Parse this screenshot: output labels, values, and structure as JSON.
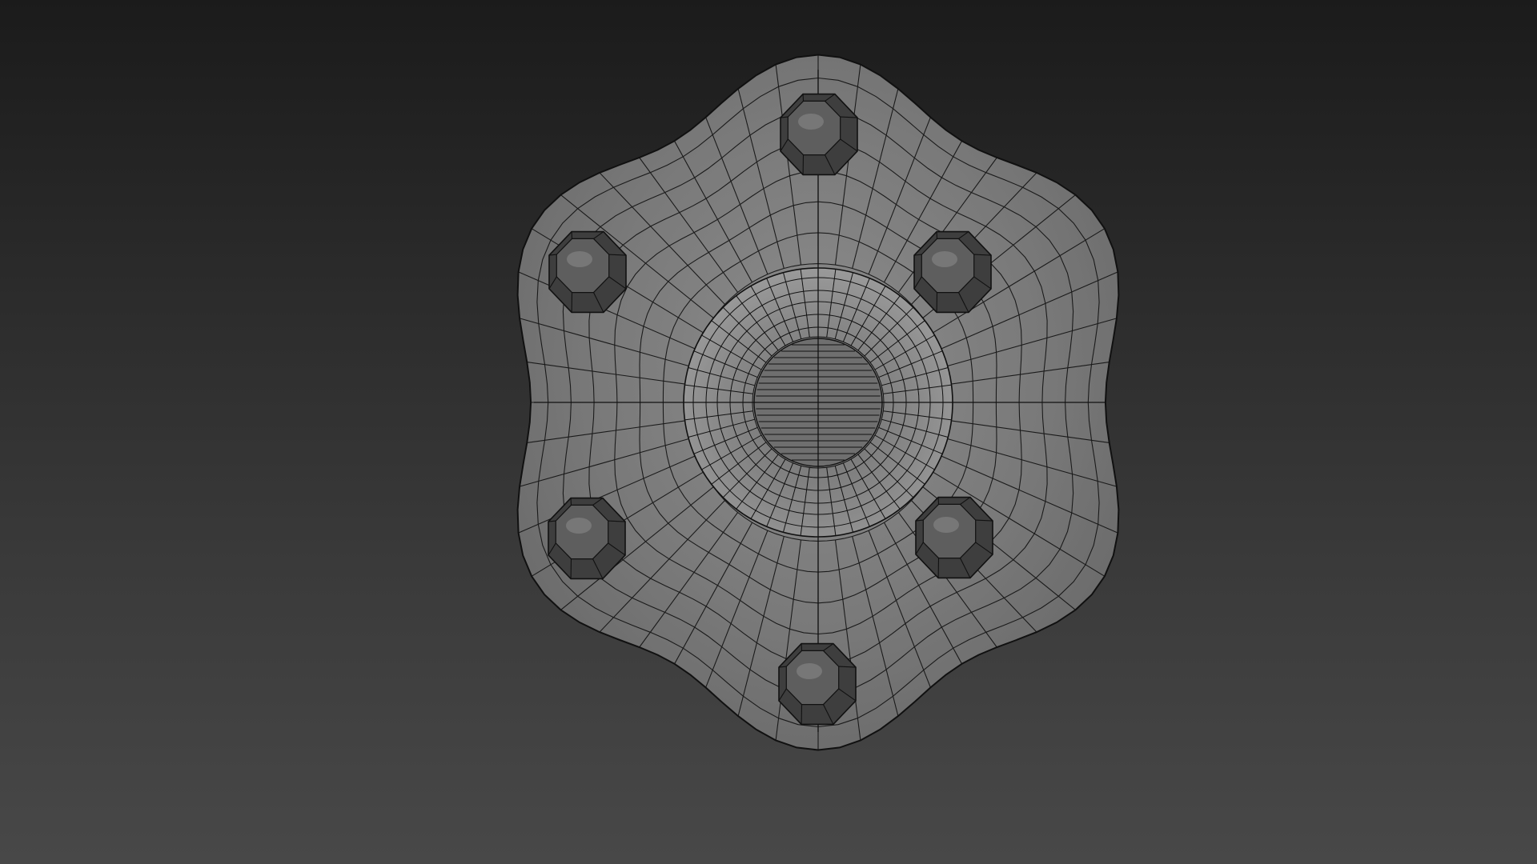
{
  "viewport": {
    "background_top": "#1b1b1b",
    "background_bottom": "#484848",
    "shading": "wireframe-on-shaded"
  },
  "model": {
    "object": "hub-with-six-lug-nuts",
    "lug_nut_count": 6,
    "body_color": "#7c7c7c",
    "wire_color": "#111111",
    "nut_color": "#5e5e5e"
  }
}
